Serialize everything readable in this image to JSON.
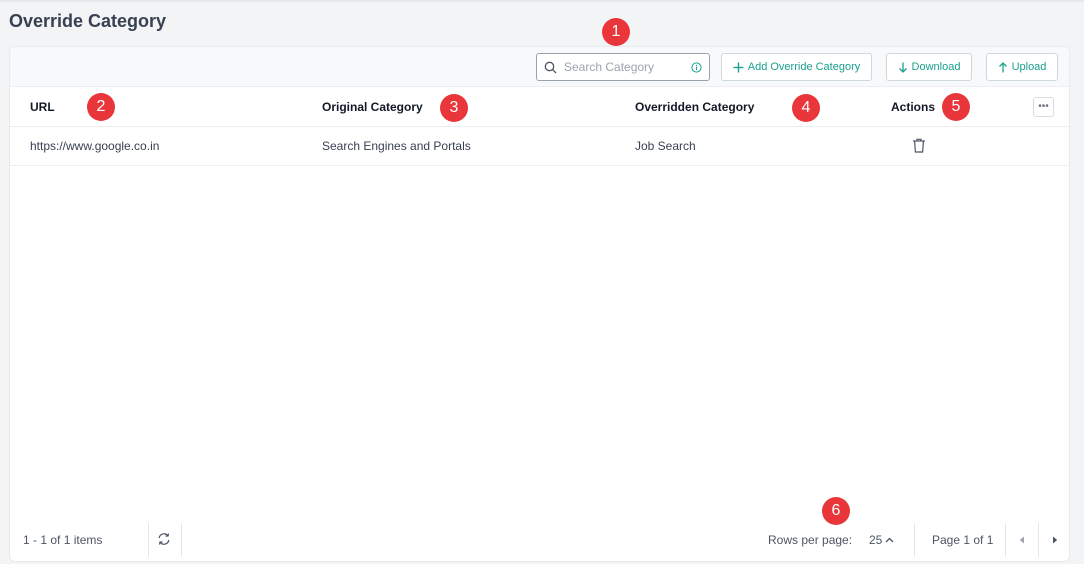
{
  "page": {
    "title": "Override Category"
  },
  "toolbar": {
    "search_placeholder": "Search Category",
    "add_label": "Add Override Category",
    "download_label": "Download",
    "upload_label": "Upload"
  },
  "table": {
    "columns": [
      "URL",
      "Original Category",
      "Overridden Category",
      "Actions"
    ],
    "rows": [
      {
        "url": "https://www.google.co.in",
        "original": "Search Engines and Portals",
        "overridden": "Job Search"
      }
    ]
  },
  "footer": {
    "items_text": "1 - 1 of 1 items",
    "rows_per_page_label": "Rows per page:",
    "rows_per_page_value": "25",
    "page_text": "Page 1 of 1"
  },
  "callouts": [
    "1",
    "2",
    "3",
    "4",
    "5",
    "6"
  ],
  "colors": {
    "accent": "#1aa08e",
    "callout": "#e8363b"
  },
  "icons": [
    "search-icon",
    "info-icon",
    "plus-icon",
    "download-icon",
    "upload-icon",
    "more-icon",
    "trash-icon",
    "refresh-icon",
    "chevron-up-icon",
    "prev-page-icon",
    "next-page-icon"
  ]
}
